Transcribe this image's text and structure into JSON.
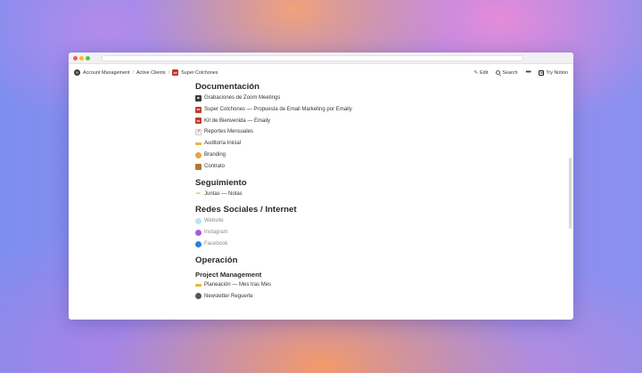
{
  "breadcrumb": {
    "items": [
      "Account Management",
      "Active Clients",
      "Super Colchones"
    ],
    "separator": "/"
  },
  "toolbar": {
    "edit_label": "Edit",
    "search_label": "Search",
    "more_label": "•••",
    "try_notion_label": "Try Notion"
  },
  "sections": {
    "documentacion": {
      "title": "Documentación",
      "items": [
        {
          "label": "Grabaciones de Zoom Meetings",
          "icon": "video-camera-icon"
        },
        {
          "label": "Super Colchones — Propuesta de Email Marketing por Emaily",
          "icon": "super-colchones-icon"
        },
        {
          "label": "Kit de Bienvenida — Emaily",
          "icon": "super-colchones-icon"
        },
        {
          "label": "Reportes Mensuales",
          "icon": "chart-increasing-icon"
        },
        {
          "label": "Auditoría Inicial",
          "icon": "ruler-icon"
        },
        {
          "label": "Branding",
          "icon": "palette-icon"
        },
        {
          "label": "Contrato",
          "icon": "abacus-icon"
        }
      ]
    },
    "seguimiento": {
      "title": "Seguimiento",
      "items": [
        {
          "label": "Juntas — Notas",
          "icon": "pencil-icon"
        }
      ]
    },
    "redes": {
      "title": "Redes Sociales / Internet",
      "items": [
        {
          "label": "Website",
          "icon": "globe-icon"
        },
        {
          "label": "Instagram",
          "icon": "purple-circle-icon"
        },
        {
          "label": "Facebook",
          "icon": "blue-globe-icon"
        }
      ]
    },
    "operacion": {
      "title": "Operación",
      "subtitle": "Project Management",
      "items": [
        {
          "label": "Planeación — Mes tras Mes",
          "icon": "ruler-icon"
        },
        {
          "label": "Newsletter Reguerte",
          "icon": "circle-icon"
        }
      ]
    }
  },
  "colors": {
    "accent_red": "#c0392b",
    "text": "#37352f",
    "faded_text": "#8d8c88"
  }
}
